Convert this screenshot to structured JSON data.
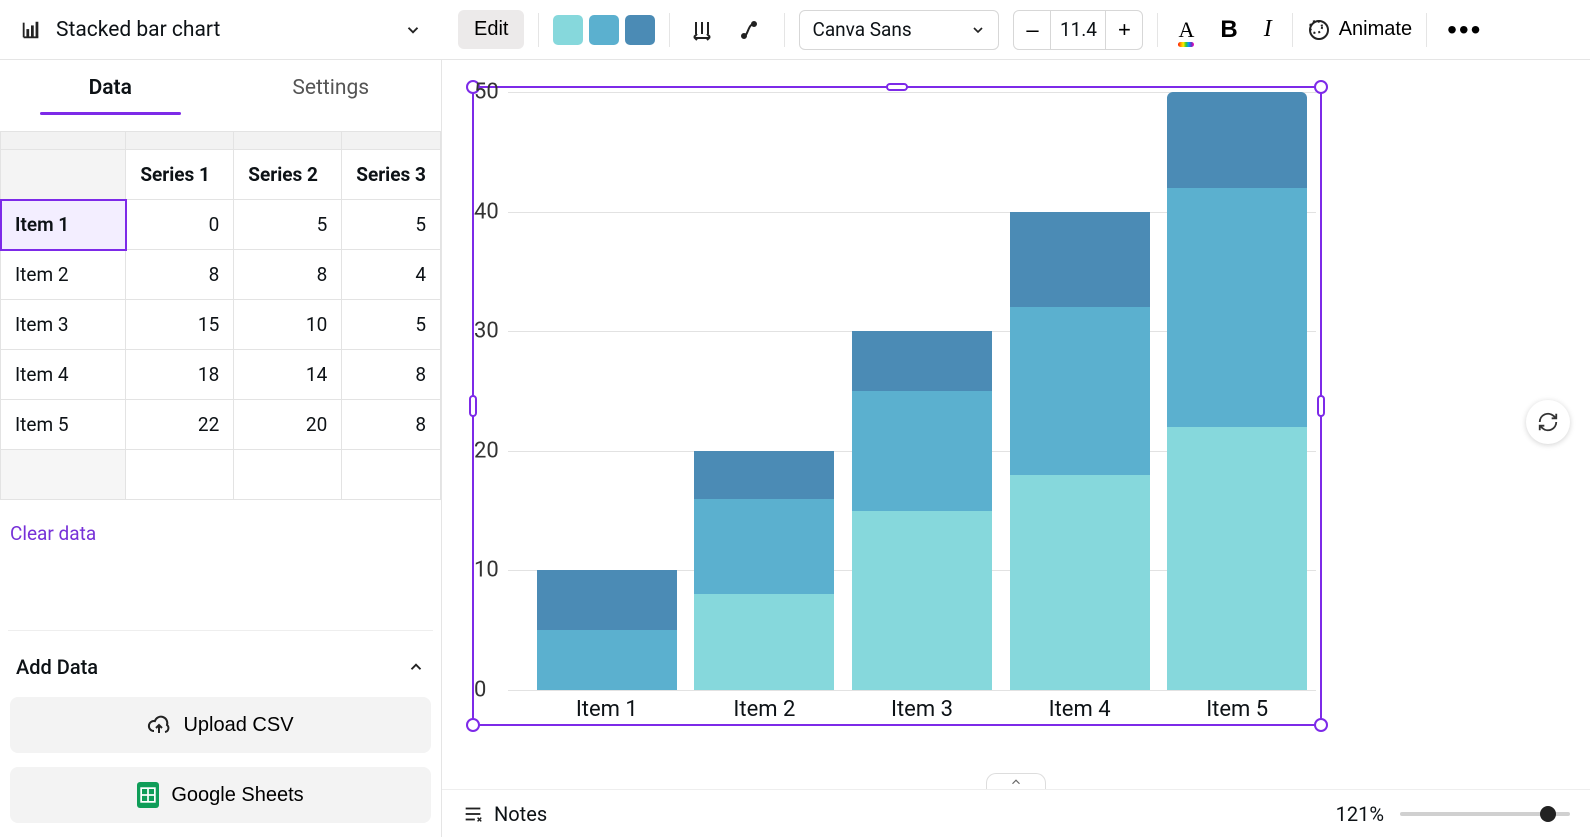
{
  "toolbar": {
    "chart_title": "Stacked bar chart",
    "edit_label": "Edit",
    "font_name": "Canva Sans",
    "font_size": "11.4",
    "animate_label": "Animate"
  },
  "tabs": {
    "data": "Data",
    "settings": "Settings"
  },
  "table": {
    "series_headers": [
      "Series 1",
      "Series 2",
      "Series 3"
    ],
    "rows": [
      {
        "label": "Item 1",
        "vals": [
          0,
          5,
          5
        ]
      },
      {
        "label": "Item 2",
        "vals": [
          8,
          8,
          4
        ]
      },
      {
        "label": "Item 3",
        "vals": [
          15,
          10,
          5
        ]
      },
      {
        "label": "Item 4",
        "vals": [
          18,
          14,
          8
        ]
      },
      {
        "label": "Item 5",
        "vals": [
          22,
          20,
          8
        ]
      }
    ],
    "clear_label": "Clear data"
  },
  "adddata": {
    "heading": "Add Data",
    "upload_label": "Upload CSV",
    "sheets_label": "Google Sheets"
  },
  "footer": {
    "notes": "Notes",
    "zoom": "121%"
  },
  "colors": {
    "s1": "#86d8dc",
    "s2": "#5bb0cf",
    "s3": "#4b8bb5",
    "accent": "#7d2ae8"
  },
  "chart_data": {
    "type": "bar",
    "stacked": true,
    "categories": [
      "Item 1",
      "Item 2",
      "Item 3",
      "Item 4",
      "Item 5"
    ],
    "series": [
      {
        "name": "Series 1",
        "values": [
          0,
          8,
          15,
          18,
          22
        ],
        "color": "#86d8dc"
      },
      {
        "name": "Series 2",
        "values": [
          5,
          8,
          10,
          14,
          20
        ],
        "color": "#5bb0cf"
      },
      {
        "name": "Series 3",
        "values": [
          5,
          4,
          5,
          8,
          8
        ],
        "color": "#4b8bb5"
      }
    ],
    "ylim": [
      0,
      50
    ],
    "yticks": [
      0,
      10,
      20,
      30,
      40,
      50
    ],
    "title": "",
    "xlabel": "",
    "ylabel": ""
  }
}
